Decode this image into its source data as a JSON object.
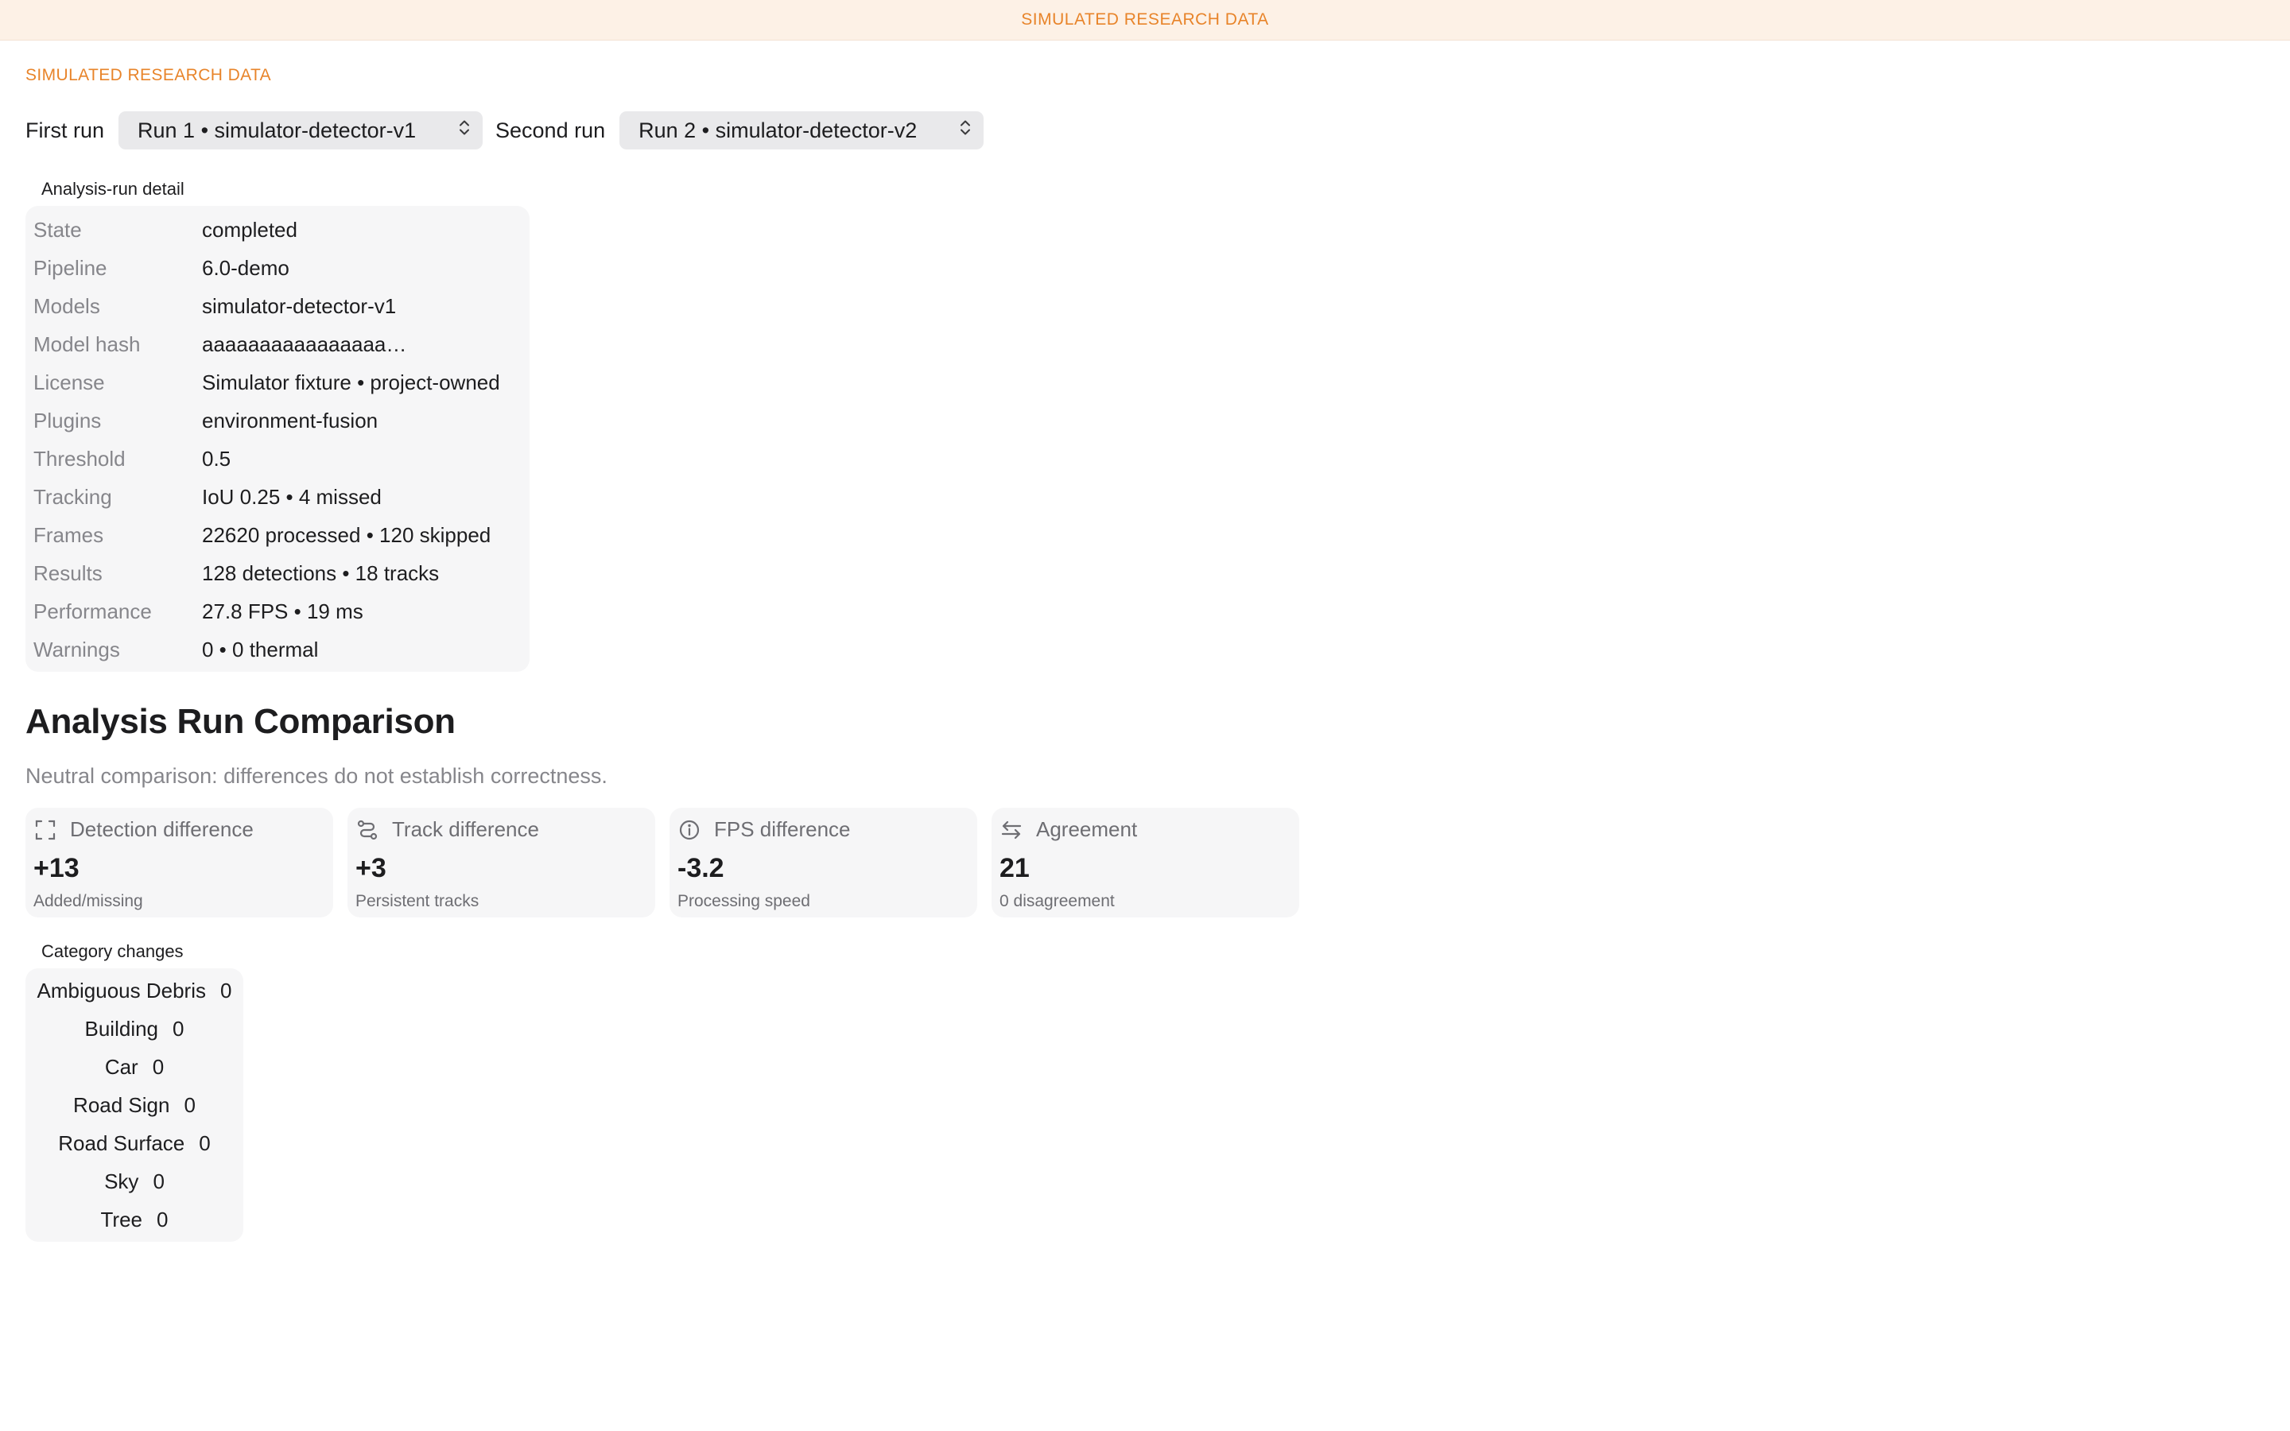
{
  "banner": "SIMULATED RESEARCH DATA",
  "sim_label": "SIMULATED RESEARCH DATA",
  "selectors": {
    "first_label": "First run",
    "first_value": "Run 1 • simulator-detector-v1",
    "second_label": "Second run",
    "second_value": "Run 2 • simulator-detector-v2"
  },
  "detail": {
    "title": "Analysis-run detail",
    "rows": [
      {
        "key": "State",
        "value": "completed"
      },
      {
        "key": "Pipeline",
        "value": "6.0-demo"
      },
      {
        "key": "Models",
        "value": "simulator-detector-v1"
      },
      {
        "key": "Model hash",
        "value": "aaaaaaaaaaaaaaaa…"
      },
      {
        "key": "License",
        "value": "Simulator fixture • project-owned"
      },
      {
        "key": "Plugins",
        "value": "environment-fusion"
      },
      {
        "key": "Threshold",
        "value": "0.5"
      },
      {
        "key": "Tracking",
        "value": "IoU 0.25 • 4 missed"
      },
      {
        "key": "Frames",
        "value": "22620 processed • 120 skipped"
      },
      {
        "key": "Results",
        "value": "128 detections • 18 tracks"
      },
      {
        "key": "Performance",
        "value": "27.8 FPS • 19 ms"
      },
      {
        "key": "Warnings",
        "value": "0 • 0 thermal"
      }
    ]
  },
  "comparison": {
    "title": "Analysis Run Comparison",
    "subtitle": "Neutral comparison: differences do not establish correctness.",
    "cards": [
      {
        "label": "Detection difference",
        "value": "+13",
        "caption": "Added/missing",
        "icon": "expand-icon"
      },
      {
        "label": "Track difference",
        "value": "+3",
        "caption": "Persistent tracks",
        "icon": "route-icon"
      },
      {
        "label": "FPS difference",
        "value": "-3.2",
        "caption": "Processing speed",
        "icon": "info-icon"
      },
      {
        "label": "Agreement",
        "value": "21",
        "caption": "0 disagreement",
        "icon": "swap-arrows-icon"
      }
    ]
  },
  "categories": {
    "title": "Category changes",
    "items": [
      {
        "name": "Ambiguous Debris",
        "value": "0"
      },
      {
        "name": "Building",
        "value": "0"
      },
      {
        "name": "Car",
        "value": "0"
      },
      {
        "name": "Road Sign",
        "value": "0"
      },
      {
        "name": "Road Surface",
        "value": "0"
      },
      {
        "name": "Sky",
        "value": "0"
      },
      {
        "name": "Tree",
        "value": "0"
      }
    ]
  },
  "colors": {
    "accent": "#e8842a",
    "banner_bg": "#fdf1e6",
    "panel_bg": "#f6f6f7",
    "select_bg": "#e9e9eb",
    "muted_text": "#86868b"
  }
}
